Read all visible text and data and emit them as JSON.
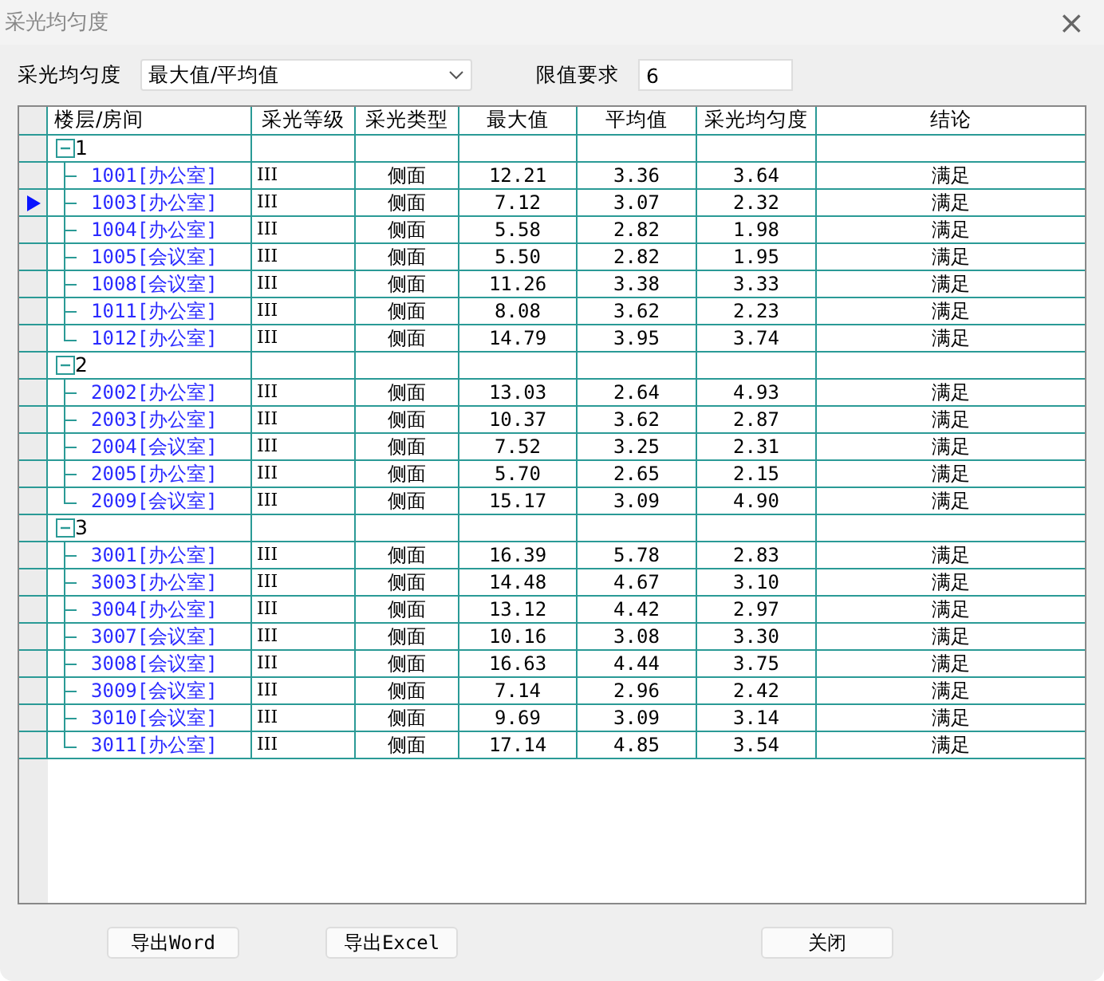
{
  "window": {
    "title": "采光均匀度",
    "close": "×"
  },
  "controls": {
    "mode_label": "采光均匀度",
    "mode_value": "最大值/平均值",
    "limit_label": "限值要求",
    "limit_value": "6"
  },
  "table": {
    "columns": [
      "楼层/房间",
      "采光等级",
      "采光类型",
      "最大值",
      "平均值",
      "采光均匀度",
      "结论"
    ],
    "groups": [
      {
        "label": "1",
        "expanded": true,
        "selected": false,
        "children": [
          {
            "cells": [
              "1001[办公室]",
              "III",
              "侧面",
              "12.21",
              "3.36",
              "3.64",
              "满足"
            ],
            "selected": false
          },
          {
            "cells": [
              "1003[办公室]",
              "III",
              "侧面",
              "7.12",
              "3.07",
              "2.32",
              "满足"
            ],
            "selected": true
          },
          {
            "cells": [
              "1004[办公室]",
              "III",
              "侧面",
              "5.58",
              "2.82",
              "1.98",
              "满足"
            ],
            "selected": false
          },
          {
            "cells": [
              "1005[会议室]",
              "III",
              "侧面",
              "5.50",
              "2.82",
              "1.95",
              "满足"
            ],
            "selected": false
          },
          {
            "cells": [
              "1008[会议室]",
              "III",
              "侧面",
              "11.26",
              "3.38",
              "3.33",
              "满足"
            ],
            "selected": false
          },
          {
            "cells": [
              "1011[办公室]",
              "III",
              "侧面",
              "8.08",
              "3.62",
              "2.23",
              "满足"
            ],
            "selected": false
          },
          {
            "cells": [
              "1012[办公室]",
              "III",
              "侧面",
              "14.79",
              "3.95",
              "3.74",
              "满足"
            ],
            "selected": false
          }
        ]
      },
      {
        "label": "2",
        "expanded": true,
        "selected": false,
        "children": [
          {
            "cells": [
              "2002[办公室]",
              "III",
              "侧面",
              "13.03",
              "2.64",
              "4.93",
              "满足"
            ],
            "selected": false
          },
          {
            "cells": [
              "2003[办公室]",
              "III",
              "侧面",
              "10.37",
              "3.62",
              "2.87",
              "满足"
            ],
            "selected": false
          },
          {
            "cells": [
              "2004[会议室]",
              "III",
              "侧面",
              "7.52",
              "3.25",
              "2.31",
              "满足"
            ],
            "selected": false
          },
          {
            "cells": [
              "2005[办公室]",
              "III",
              "侧面",
              "5.70",
              "2.65",
              "2.15",
              "满足"
            ],
            "selected": false
          },
          {
            "cells": [
              "2009[会议室]",
              "III",
              "侧面",
              "15.17",
              "3.09",
              "4.90",
              "满足"
            ],
            "selected": false
          }
        ]
      },
      {
        "label": "3",
        "expanded": true,
        "selected": false,
        "children": [
          {
            "cells": [
              "3001[办公室]",
              "III",
              "侧面",
              "16.39",
              "5.78",
              "2.83",
              "满足"
            ],
            "selected": false
          },
          {
            "cells": [
              "3003[办公室]",
              "III",
              "侧面",
              "14.48",
              "4.67",
              "3.10",
              "满足"
            ],
            "selected": false
          },
          {
            "cells": [
              "3004[办公室]",
              "III",
              "侧面",
              "13.12",
              "4.42",
              "2.97",
              "满足"
            ],
            "selected": false
          },
          {
            "cells": [
              "3007[会议室]",
              "III",
              "侧面",
              "10.16",
              "3.08",
              "3.30",
              "满足"
            ],
            "selected": false
          },
          {
            "cells": [
              "3008[会议室]",
              "III",
              "侧面",
              "16.63",
              "4.44",
              "3.75",
              "满足"
            ],
            "selected": false
          },
          {
            "cells": [
              "3009[会议室]",
              "III",
              "侧面",
              "7.14",
              "2.96",
              "2.42",
              "满足"
            ],
            "selected": false
          },
          {
            "cells": [
              "3010[会议室]",
              "III",
              "侧面",
              "9.69",
              "3.09",
              "3.14",
              "满足"
            ],
            "selected": false
          },
          {
            "cells": [
              "3011[办公室]",
              "III",
              "侧面",
              "17.14",
              "4.85",
              "3.54",
              "满足"
            ],
            "selected": false
          }
        ]
      }
    ]
  },
  "buttons": [
    "导出Word",
    "导出Excel",
    "关闭"
  ]
}
